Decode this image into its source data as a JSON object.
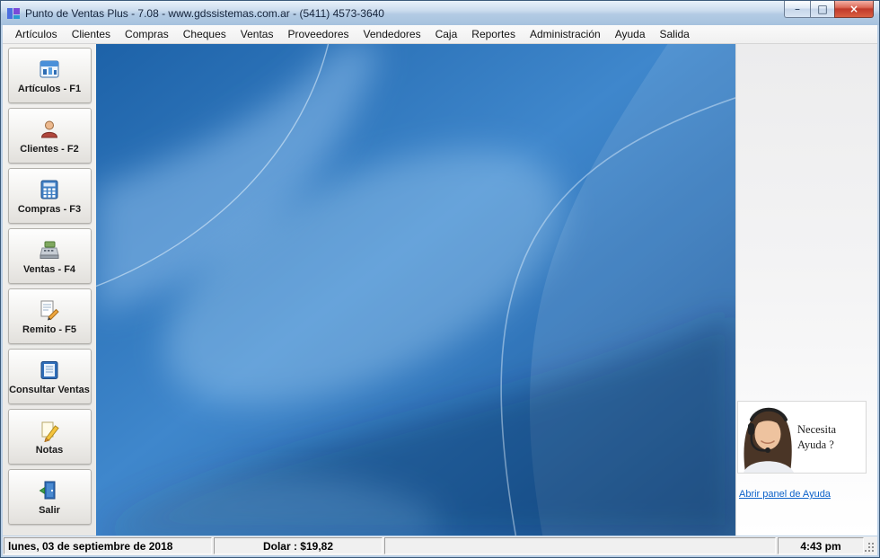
{
  "window": {
    "title": "Punto de Ventas Plus - 7.08 - www.gdssistemas.com.ar -  (5411) 4573-3640",
    "controls": {
      "minimize": "–",
      "maximize": "□",
      "close": "×"
    }
  },
  "menubar": {
    "items": [
      "Artículos",
      "Clientes",
      "Compras",
      "Cheques",
      "Ventas",
      "Proveedores",
      "Vendedores",
      "Caja",
      "Reportes",
      "Administración",
      "Ayuda",
      "Salida"
    ]
  },
  "sidebar": {
    "buttons": [
      {
        "label": "Artículos - F1",
        "icon": "articles-icon"
      },
      {
        "label": "Clientes - F2",
        "icon": "clients-icon"
      },
      {
        "label": "Compras - F3",
        "icon": "calculator-icon"
      },
      {
        "label": "Ventas - F4",
        "icon": "cash-register-icon"
      },
      {
        "label": "Remito - F5",
        "icon": "delivery-note-icon"
      },
      {
        "label": "Consultar Ventas",
        "icon": "sales-ledger-icon"
      },
      {
        "label": "Notas",
        "icon": "pencil-icon"
      },
      {
        "label": "Salir",
        "icon": "exit-door-icon"
      }
    ]
  },
  "help_panel": {
    "caption": "Necesita Ayuda ?",
    "link_label": "Abrir panel de Ayuda"
  },
  "statusbar": {
    "date": "lunes, 03 de septiembre de 2018",
    "dolar": "Dolar : $19,82",
    "time": "4:43 pm"
  },
  "colors": {
    "titlebar_blue": "#bdd3ea",
    "close_red": "#c03a2b",
    "link_blue": "#0d62c9",
    "wallpaper_blue": "#2f74b8"
  }
}
